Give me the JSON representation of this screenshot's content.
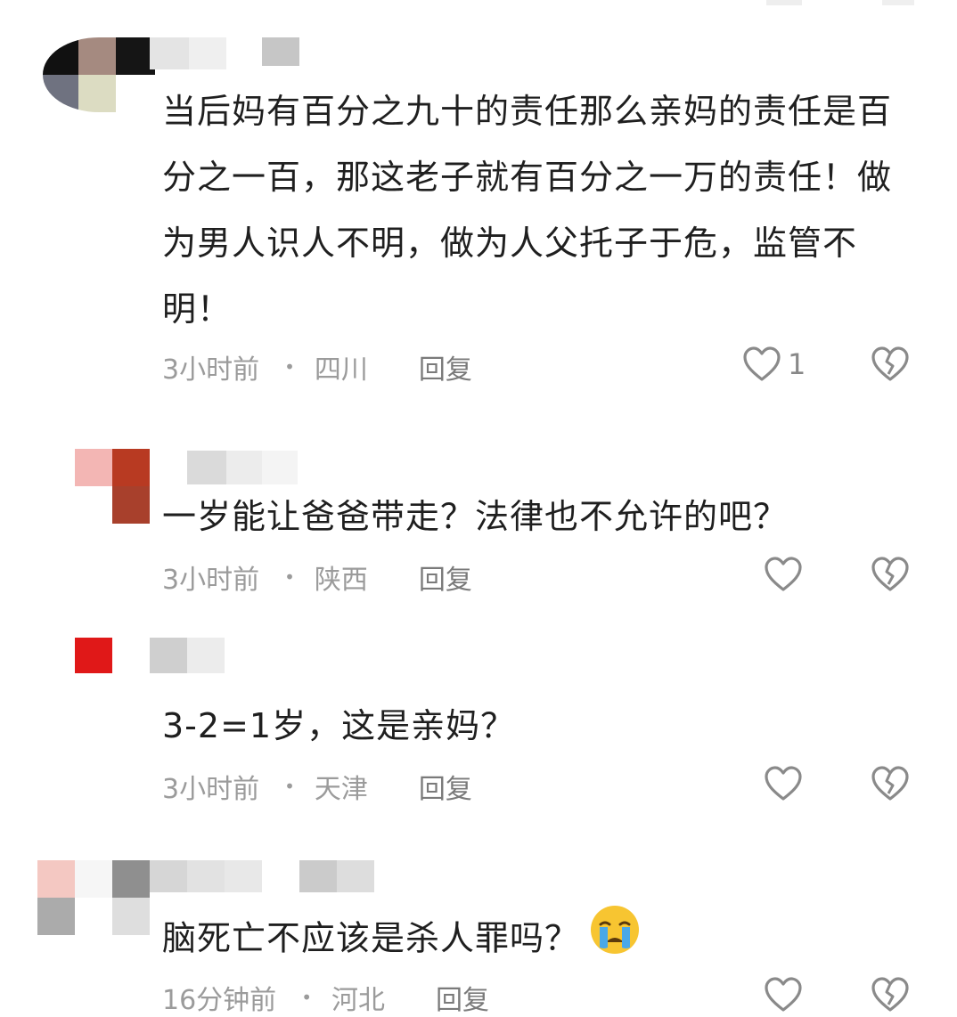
{
  "comments": [
    {
      "text": "当后妈有百分之九十的责任那么亲妈的责任是百分之一百，那这老子就有百分之一万的责任！做为男人识人不明，做为人父托子于危，监管不明！",
      "time": "3小时前",
      "location": "四川",
      "reply": "回复",
      "likes": "1"
    },
    {
      "text": "一岁能让爸爸带走？法律也不允许的吧？",
      "time": "3小时前",
      "location": "陕西",
      "reply": "回复"
    },
    {
      "text": "3-2=1岁，这是亲妈？",
      "time": "3小时前",
      "location": "天津",
      "reply": "回复"
    },
    {
      "text": "脑死亡不应该是杀人罪吗？",
      "emoji": "crying-face-emoji",
      "time": "16分钟前",
      "location": "河北",
      "reply": "回复"
    }
  ],
  "colors": {
    "meta": "#9b9b9b",
    "icon": "#8a8a8a"
  }
}
